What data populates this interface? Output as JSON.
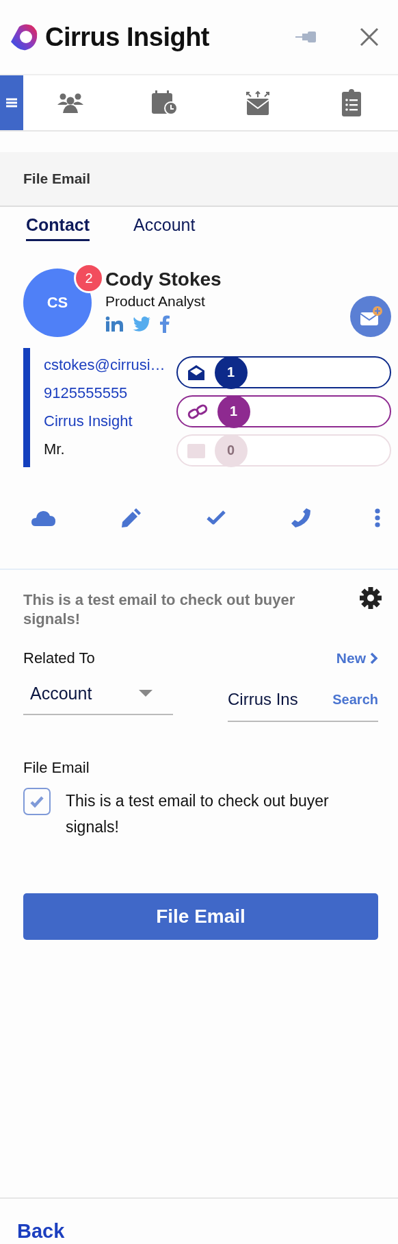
{
  "header": {
    "brand": "Cirrus Insight"
  },
  "nav_items": [
    {
      "kind": "menu",
      "selected": true
    },
    {
      "kind": "contacts",
      "selected": false
    },
    {
      "kind": "calendar",
      "selected": false
    },
    {
      "kind": "send",
      "selected": false
    },
    {
      "kind": "tasks",
      "selected": false
    }
  ],
  "section_title": "File Email",
  "tabs": [
    {
      "label": "Contact",
      "selected": true
    },
    {
      "label": "Account",
      "selected": false
    }
  ],
  "contact": {
    "initials": "CS",
    "badge": "2",
    "name": "Cody Stokes",
    "title": "Product Analyst"
  },
  "details": [
    {
      "text": "cstokes@cirrusi…",
      "kind": "link"
    },
    {
      "text": "9125555555",
      "kind": "link"
    },
    {
      "text": "Cirrus Insight",
      "kind": "link"
    },
    {
      "text": "Mr.",
      "kind": "plain"
    }
  ],
  "counters": [
    {
      "kind": "email",
      "count": "1",
      "color": "#0d2a8a"
    },
    {
      "kind": "link",
      "count": "1",
      "color": "#8e2a90"
    },
    {
      "kind": "calendar",
      "count": "0",
      "color": "#ecdde3"
    }
  ],
  "subject": "This is a test email to check out buyer signals!",
  "related": {
    "label": "Related To",
    "new_link": "New",
    "type_value": "Account",
    "record_value": "Cirrus Ins",
    "search_label": "Search"
  },
  "file_email": {
    "label": "File Email",
    "options": [
      {
        "text": "This is a test email to check out buyer signals!",
        "checked": true
      }
    ]
  },
  "submit": "File Email",
  "footer": {
    "back": "Back"
  }
}
